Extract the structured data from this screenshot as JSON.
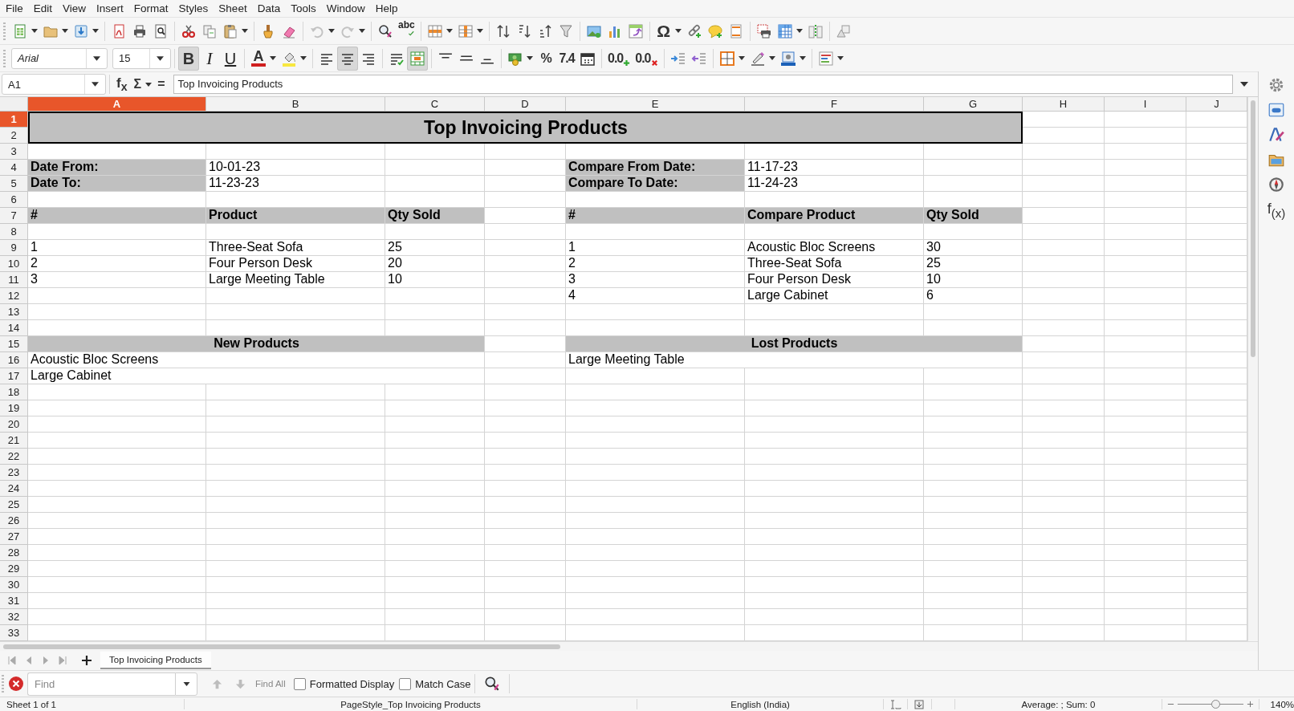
{
  "menu": [
    "File",
    "Edit",
    "View",
    "Insert",
    "Format",
    "Styles",
    "Sheet",
    "Data",
    "Tools",
    "Window",
    "Help"
  ],
  "standard_toolbar": {
    "undo": {
      "disabled": true
    },
    "redo": {
      "disabled": true
    },
    "spelling": {
      "label": "abc"
    },
    "special_character": {
      "label": "Ω"
    }
  },
  "formatting_toolbar": {
    "font_name": "Arial",
    "font_size": "15",
    "bold": {
      "label": "B",
      "selected": true
    },
    "italic": {
      "label": "I",
      "selected": false
    },
    "underline": {
      "label": "U",
      "selected": false
    },
    "font_color": {
      "label": "A"
    },
    "align_left": {
      "selected": false
    },
    "align_center": {
      "selected": true
    },
    "align_right": {
      "selected": false
    },
    "merge_cells": {
      "selected": true
    },
    "percent": {
      "label": "%"
    },
    "number": {
      "label": "7.4"
    },
    "add_decimal": {
      "label": "0.0"
    },
    "delete_decimal": {
      "label": "0.0"
    }
  },
  "formula_bar": {
    "name_box": "A1",
    "function_wizard": "f$_{x}$",
    "sum": "Σ",
    "equals": "=",
    "content": "Top Invoicing Products"
  },
  "columns": [
    {
      "label": "A",
      "selected": true
    },
    {
      "label": "B",
      "selected": false
    },
    {
      "label": "C",
      "selected": false
    },
    {
      "label": "D",
      "selected": false
    },
    {
      "label": "E",
      "selected": false
    },
    {
      "label": "F",
      "selected": false
    },
    {
      "label": "G",
      "selected": false
    },
    {
      "label": "H",
      "selected": false
    },
    {
      "label": "I",
      "selected": false
    },
    {
      "label": "J",
      "selected": false
    }
  ],
  "rows": [
    {
      "label": "1",
      "selected": true,
      "cells": [
        {
          "kind": "title",
          "text": "Top Invoicing Products",
          "selected": true
        }
      ]
    },
    {
      "label": "2",
      "selected": false
    },
    {
      "label": "3",
      "selected": false
    },
    {
      "label": "4",
      "selected": false,
      "cells": [
        {
          "kind": "label",
          "text": "Date From:",
          "selected": false
        },
        {
          "kind": "value",
          "text": "10-01-23",
          "selected": false
        },
        null,
        null,
        {
          "kind": "label",
          "text": "Compare From Date:",
          "selected": false
        },
        {
          "kind": "value",
          "text": "11-17-23",
          "selected": false
        }
      ]
    },
    {
      "label": "5",
      "selected": false,
      "cells": [
        {
          "kind": "label",
          "text": "Date To:",
          "selected": false
        },
        {
          "kind": "value",
          "text": "11-23-23",
          "selected": false
        },
        null,
        null,
        {
          "kind": "label",
          "text": "Compare To Date:",
          "selected": false
        },
        {
          "kind": "value",
          "text": "11-24-23",
          "selected": false
        }
      ]
    },
    {
      "label": "6",
      "selected": false
    },
    {
      "label": "7",
      "selected": false,
      "cells": [
        {
          "kind": "label",
          "text": "#",
          "selected": false
        },
        {
          "kind": "label",
          "text": "Product",
          "selected": false
        },
        {
          "kind": "label",
          "text": "Qty Sold",
          "selected": false
        },
        null,
        {
          "kind": "label",
          "text": "#",
          "selected": false
        },
        {
          "kind": "label",
          "text": "Compare Product",
          "selected": false
        },
        {
          "kind": "label",
          "text": "Qty Sold",
          "selected": false
        }
      ]
    },
    {
      "label": "8",
      "selected": false
    },
    {
      "label": "9",
      "selected": false,
      "cells": [
        {
          "kind": "value",
          "text": "1",
          "selected": false
        },
        {
          "kind": "value",
          "text": "Three-Seat Sofa",
          "selected": false
        },
        {
          "kind": "value",
          "text": "25",
          "selected": false
        },
        null,
        {
          "kind": "value",
          "text": "1",
          "selected": false
        },
        {
          "kind": "value",
          "text": "Acoustic Bloc Screens",
          "selected": false
        },
        {
          "kind": "value",
          "text": "30",
          "selected": false
        }
      ]
    },
    {
      "label": "10",
      "selected": false,
      "cells": [
        {
          "kind": "value",
          "text": "2",
          "selected": false
        },
        {
          "kind": "value",
          "text": "Four Person Desk",
          "selected": false
        },
        {
          "kind": "value",
          "text": "20",
          "selected": false
        },
        null,
        {
          "kind": "value",
          "text": "2",
          "selected": false
        },
        {
          "kind": "value",
          "text": "Three-Seat Sofa",
          "selected": false
        },
        {
          "kind": "value",
          "text": "25",
          "selected": false
        }
      ]
    },
    {
      "label": "11",
      "selected": false,
      "cells": [
        {
          "kind": "value",
          "text": "3",
          "selected": false
        },
        {
          "kind": "value",
          "text": "Large Meeting Table",
          "selected": false
        },
        {
          "kind": "value",
          "text": "10",
          "selected": false
        },
        null,
        {
          "kind": "value",
          "text": "3",
          "selected": false
        },
        {
          "kind": "value",
          "text": "Four Person Desk",
          "selected": false
        },
        {
          "kind": "value",
          "text": "10",
          "selected": false
        }
      ]
    },
    {
      "label": "12",
      "selected": false,
      "cells": [
        null,
        null,
        null,
        null,
        {
          "kind": "value",
          "text": "4",
          "selected": false
        },
        {
          "kind": "value",
          "text": "Large Cabinet",
          "selected": false
        },
        {
          "kind": "value",
          "text": "6",
          "selected": false
        }
      ]
    },
    {
      "label": "13",
      "selected": false
    },
    {
      "label": "14",
      "selected": false
    },
    {
      "label": "15",
      "selected": false,
      "cells": [
        {
          "kind": "band",
          "text": "New Products",
          "selected": false
        },
        null,
        {
          "kind": "band",
          "text": "Lost Products",
          "selected": false
        }
      ]
    },
    {
      "label": "16",
      "selected": false,
      "cells": [
        {
          "kind": "wide",
          "text": "Acoustic Bloc Screens",
          "selected": false
        },
        null,
        {
          "kind": "wide",
          "text": "Large Meeting Table",
          "selected": false
        }
      ]
    },
    {
      "label": "17",
      "selected": false,
      "cells": [
        {
          "kind": "wide",
          "text": "Large Cabinet",
          "selected": false
        }
      ]
    },
    {
      "label": "18",
      "selected": false
    },
    {
      "label": "19",
      "selected": false
    },
    {
      "label": "20",
      "selected": false
    },
    {
      "label": "21",
      "selected": false
    },
    {
      "label": "22",
      "selected": false
    },
    {
      "label": "23",
      "selected": false
    },
    {
      "label": "24",
      "selected": false
    },
    {
      "label": "25",
      "selected": false
    },
    {
      "label": "26",
      "selected": false
    },
    {
      "label": "27",
      "selected": false
    },
    {
      "label": "28",
      "selected": false
    },
    {
      "label": "29",
      "selected": false
    },
    {
      "label": "30",
      "selected": false
    },
    {
      "label": "31",
      "selected": false
    },
    {
      "label": "32",
      "selected": false
    },
    {
      "label": "33",
      "selected": false
    }
  ],
  "sidebar": {
    "functions_label": "f$_{(x)}$"
  },
  "sheet_tabs": [
    {
      "label": "Top Invoicing Products",
      "selected": true
    }
  ],
  "find_bar": {
    "placeholder": "Find",
    "find_previous": {
      "disabled": true
    },
    "find_next": {
      "disabled": true
    },
    "find_all": {
      "label": "Find All",
      "disabled": true
    },
    "options": [
      {
        "label": "Formatted Display",
        "checked": false
      },
      {
        "label": "Match Case",
        "checked": false
      }
    ]
  },
  "status_bar": {
    "sheet": "Sheet 1 of 1",
    "page_style": "PageStyle_Top Invoicing Products",
    "language": "English (India)",
    "summary": "Average: ; Sum: 0",
    "zoom": {
      "level": 0.58
    },
    "zoom_percent": "140%"
  }
}
